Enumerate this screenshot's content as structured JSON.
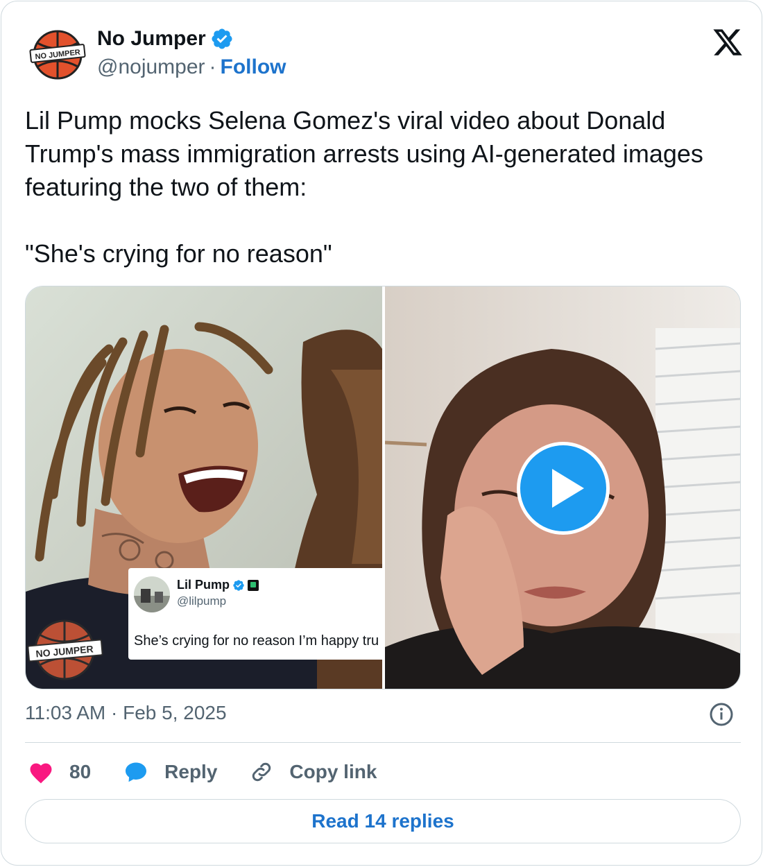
{
  "author": {
    "display_name": "No Jumper",
    "handle": "@nojumper",
    "separator": "·",
    "follow_label": "Follow",
    "avatar_text": "NO JUMPER",
    "verified": true
  },
  "tweet": {
    "text": "Lil Pump mocks Selena Gomez's viral video about Donald Trump's mass immigration arrests using AI-generated images featuring the two of them:\n\n\"She's crying for no reason\"",
    "timestamp": "11:03 AM · Feb 5, 2025"
  },
  "media": {
    "embedded_post": {
      "name": "Lil Pump",
      "handle": "@lilpump",
      "text": "She’s crying for no reason I’m happy tru"
    },
    "watermark_text": "NO JUMPER",
    "has_video": true
  },
  "actions": {
    "likes_count": "80",
    "reply_label": "Reply",
    "copy_link_label": "Copy link",
    "read_replies_label": "Read 14 replies"
  },
  "colors": {
    "accent": "#1d73cc",
    "verified_blue": "#1d9bf0",
    "heart": "#f91880",
    "secondary_text": "#536471",
    "border": "#cfd9de",
    "basketball_orange": "#e2512c"
  },
  "icons": {
    "verified": "verified-badge-icon",
    "platform": "x-logo-icon",
    "info": "info-icon",
    "like": "heart-icon",
    "reply": "speech-bubble-icon",
    "copy": "link-icon",
    "play": "play-icon"
  }
}
